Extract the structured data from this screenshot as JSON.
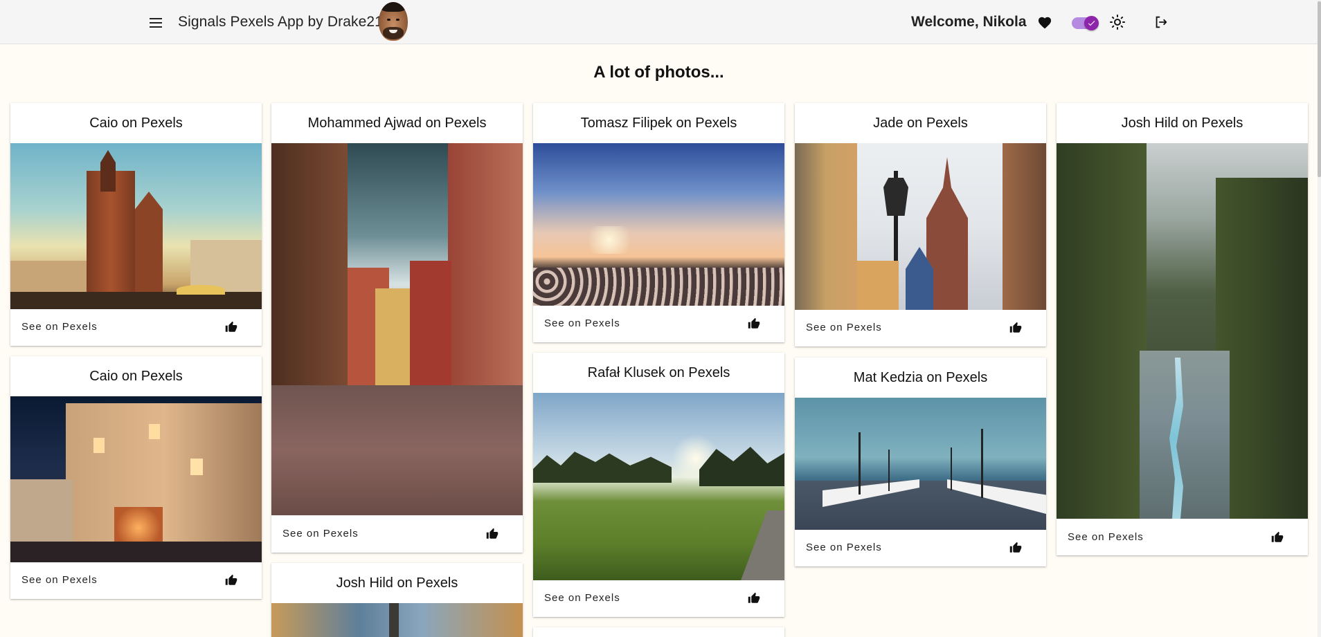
{
  "header": {
    "app_title": "Signals Pexels App by Drake21",
    "welcome": "Welcome, Nikola",
    "icons": {
      "menu": "menu-icon",
      "favorites": "heart-icon",
      "theme_toggle": "toggle-check-icon",
      "light_mode": "sun-icon",
      "logout": "logout-icon"
    },
    "accent_color": "#8e24aa"
  },
  "page": {
    "heading": "A lot of photos..."
  },
  "cards": [
    {
      "title": "Caio on Pexels",
      "link": "See on Pexels",
      "photo": "krakow-st-marys-basilica"
    },
    {
      "title": "Caio on Pexels",
      "link": "See on Pexels",
      "photo": "old-town-night-street"
    },
    {
      "title": "Mohammed Ajwad on Pexels",
      "link": "See on Pexels",
      "photo": "warsaw-cobblestone-street"
    },
    {
      "title": "Josh Hild on Pexels",
      "link": "",
      "photo": "old-town-tower"
    },
    {
      "title": "Tomasz Filipek on Pexels",
      "link": "See on Pexels",
      "photo": "sunset-cotton-field"
    },
    {
      "title": "Rafał Klusek on Pexels",
      "link": "See on Pexels",
      "photo": "sunny-green-meadow"
    },
    {
      "title": "Jade on Pexels",
      "link": "See on Pexels",
      "photo": "street-lamp-and-church"
    },
    {
      "title": "Mat Kedzia on Pexels",
      "link": "See on Pexels",
      "photo": "seaside-pier"
    },
    {
      "title": "Josh Hild on Pexels",
      "link": "See on Pexels",
      "photo": "forest-river-aerial"
    }
  ],
  "card_icons": {
    "like": "thumb-up-icon"
  }
}
